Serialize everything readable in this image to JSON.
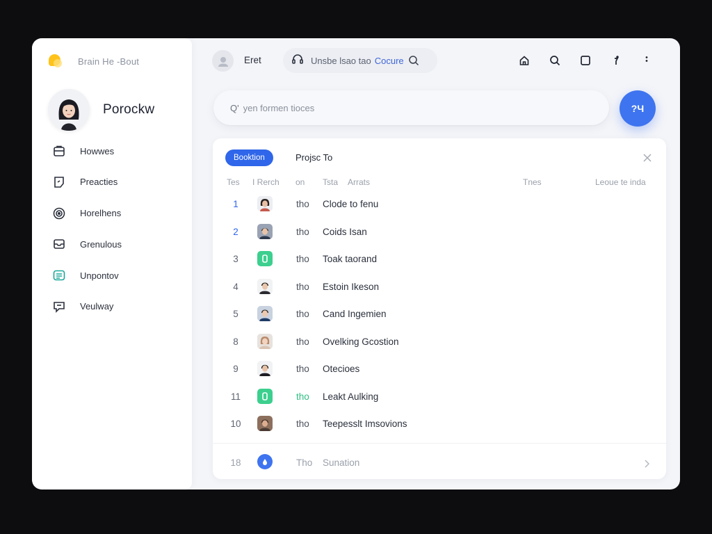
{
  "brand": {
    "title": "Brain He -Bout"
  },
  "profile": {
    "name": "Porockw"
  },
  "sidebar": {
    "items": [
      {
        "label": "Howwes",
        "icon": "briefcase-icon"
      },
      {
        "label": "Preacties",
        "icon": "note-icon"
      },
      {
        "label": "Horelhens",
        "icon": "spiral-icon"
      },
      {
        "label": "Grenulous",
        "icon": "inbox-icon"
      },
      {
        "label": "Unpontov",
        "icon": "list-icon"
      },
      {
        "label": "Veulway",
        "icon": "chat-icon"
      }
    ]
  },
  "topbar": {
    "user": "Eret",
    "pill_text": "Unsbe lsao tao",
    "pill_accent": "Cocure"
  },
  "search": {
    "placeholder": "yen formen tioces",
    "prefix": "Q'"
  },
  "fab": {
    "label": "?Ч"
  },
  "panel": {
    "chip": "Booktion",
    "title": "Projsc To",
    "headers": {
      "c1": "Tes",
      "c2": "I Rerch",
      "c3": "on",
      "c4": "Tsta",
      "c5": "Arrats",
      "c6": "Tnes",
      "c7": "Leoue te inda"
    },
    "rows": [
      {
        "num": "1",
        "code": "tho",
        "name": "Clode to fenu"
      },
      {
        "num": "2",
        "code": "tho",
        "name": "Coids Isan"
      },
      {
        "num": "3",
        "code": "tho",
        "name": "Toak taorand"
      },
      {
        "num": "4",
        "code": "tho",
        "name": "Estoin Ikeson"
      },
      {
        "num": "5",
        "code": "tho",
        "name": "Cand Ingemien"
      },
      {
        "num": "8",
        "code": "tho",
        "name": "Ovelking Gcostion"
      },
      {
        "num": "9",
        "code": "tho",
        "name": "Otecioes"
      },
      {
        "num": "11",
        "code": "tho",
        "name": "Leakt Aulking"
      },
      {
        "num": "10",
        "code": "tho",
        "name": "Teepesslt Imsovions"
      }
    ],
    "footer": {
      "num": "18",
      "code": "Tho",
      "name": "Sunation"
    }
  },
  "colors": {
    "accent": "#2f66ea",
    "green": "#3ccf8e",
    "brand": "#ffc21a"
  }
}
